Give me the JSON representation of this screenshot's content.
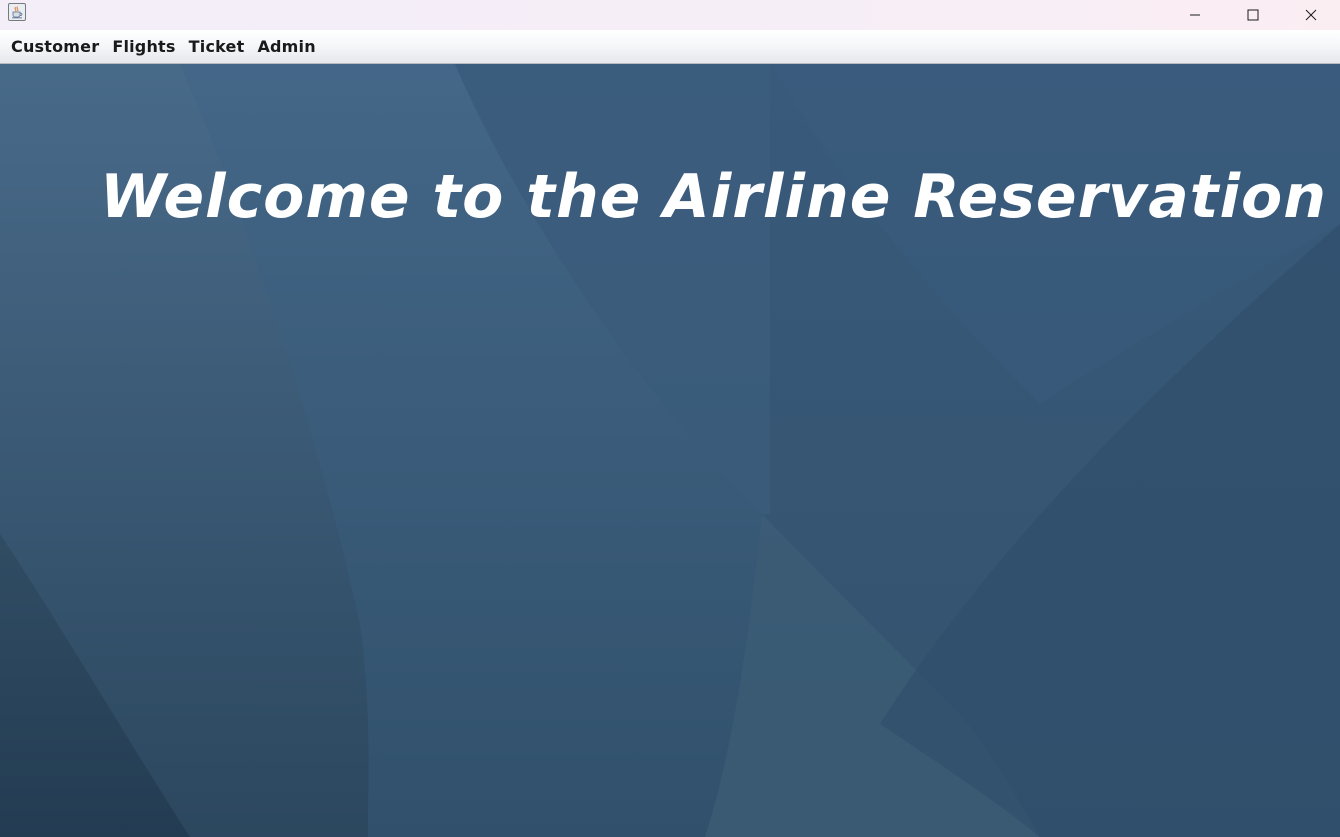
{
  "window": {
    "controls": {
      "minimize_icon": "minimize-icon",
      "maximize_icon": "maximize-icon",
      "close_icon": "close-icon"
    },
    "app_icon": "java-coffee-cup-icon"
  },
  "menubar": {
    "items": [
      {
        "label": "Customer"
      },
      {
        "label": "Flights"
      },
      {
        "label": "Ticket"
      },
      {
        "label": "Admin"
      }
    ]
  },
  "content": {
    "welcome_text": "Welcome to the Airline Reservation"
  },
  "colors": {
    "background": "#3a5a78",
    "welcome_text": "#ffffff",
    "menu_text": "#1a1a1a"
  }
}
